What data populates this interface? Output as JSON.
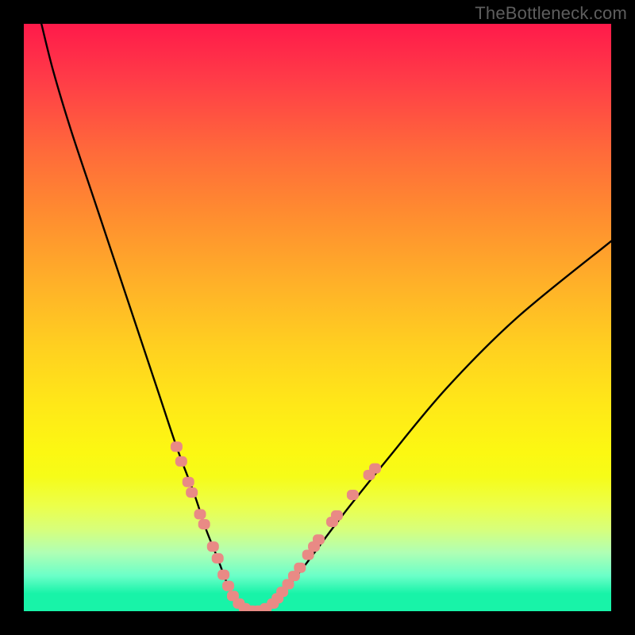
{
  "watermark": "TheBottleneck.com",
  "chart_data": {
    "type": "line",
    "title": "",
    "xlabel": "",
    "ylabel": "",
    "xlim": [
      0,
      100
    ],
    "ylim": [
      0,
      100
    ],
    "curve": {
      "name": "bottleneck-curve",
      "x": [
        3,
        5,
        8,
        12,
        16,
        20,
        23,
        26,
        29,
        31,
        33,
        34.5,
        36,
        38,
        40,
        42,
        44,
        48,
        54,
        62,
        72,
        84,
        100
      ],
      "y": [
        100,
        92,
        82,
        70,
        58,
        46,
        37,
        28,
        20,
        14,
        9,
        5,
        2,
        0,
        0,
        1,
        3,
        8,
        16,
        26,
        38,
        50,
        63
      ]
    },
    "highlighted_points": {
      "name": "highlight-markers",
      "color": "#e98a85",
      "points": [
        {
          "x": 26.0,
          "y": 28.0
        },
        {
          "x": 26.8,
          "y": 25.5
        },
        {
          "x": 28.0,
          "y": 22.0
        },
        {
          "x": 28.6,
          "y": 20.2
        },
        {
          "x": 30.0,
          "y": 16.5
        },
        {
          "x": 30.7,
          "y": 14.8
        },
        {
          "x": 32.2,
          "y": 11.0
        },
        {
          "x": 33.0,
          "y": 9.0
        },
        {
          "x": 34.0,
          "y": 6.2
        },
        {
          "x": 34.8,
          "y": 4.3
        },
        {
          "x": 35.6,
          "y": 2.6
        },
        {
          "x": 36.6,
          "y": 1.3
        },
        {
          "x": 37.6,
          "y": 0.5
        },
        {
          "x": 38.8,
          "y": 0.1
        },
        {
          "x": 40.0,
          "y": 0.1
        },
        {
          "x": 41.2,
          "y": 0.5
        },
        {
          "x": 42.4,
          "y": 1.3
        },
        {
          "x": 43.2,
          "y": 2.2
        },
        {
          "x": 44.0,
          "y": 3.3
        },
        {
          "x": 45.0,
          "y": 4.6
        },
        {
          "x": 46.0,
          "y": 6.0
        },
        {
          "x": 47.0,
          "y": 7.4
        },
        {
          "x": 48.4,
          "y": 9.6
        },
        {
          "x": 49.4,
          "y": 11.0
        },
        {
          "x": 50.2,
          "y": 12.2
        },
        {
          "x": 52.5,
          "y": 15.2
        },
        {
          "x": 53.3,
          "y": 16.3
        },
        {
          "x": 56.0,
          "y": 19.8
        },
        {
          "x": 58.8,
          "y": 23.2
        },
        {
          "x": 59.8,
          "y": 24.3
        }
      ]
    },
    "gradient_stops": [
      {
        "pos": 0.0,
        "color": "#ff1a4a"
      },
      {
        "pos": 0.09,
        "color": "#ff3a48"
      },
      {
        "pos": 0.22,
        "color": "#ff6b3a"
      },
      {
        "pos": 0.32,
        "color": "#ff8b30"
      },
      {
        "pos": 0.45,
        "color": "#ffb328"
      },
      {
        "pos": 0.55,
        "color": "#ffd020"
      },
      {
        "pos": 0.65,
        "color": "#ffe818"
      },
      {
        "pos": 0.73,
        "color": "#fcf812"
      },
      {
        "pos": 0.77,
        "color": "#f6fc18"
      },
      {
        "pos": 0.82,
        "color": "#ecff4a"
      },
      {
        "pos": 0.86,
        "color": "#d8ff7a"
      },
      {
        "pos": 0.9,
        "color": "#b0ffb4"
      },
      {
        "pos": 0.94,
        "color": "#6affc8"
      },
      {
        "pos": 0.97,
        "color": "#18f3a8"
      },
      {
        "pos": 1.0,
        "color": "#18f3a8"
      }
    ]
  },
  "colors": {
    "frame": "#000000",
    "curve": "#000000",
    "highlight": "#e98a85",
    "watermark": "#5e5e5e"
  }
}
